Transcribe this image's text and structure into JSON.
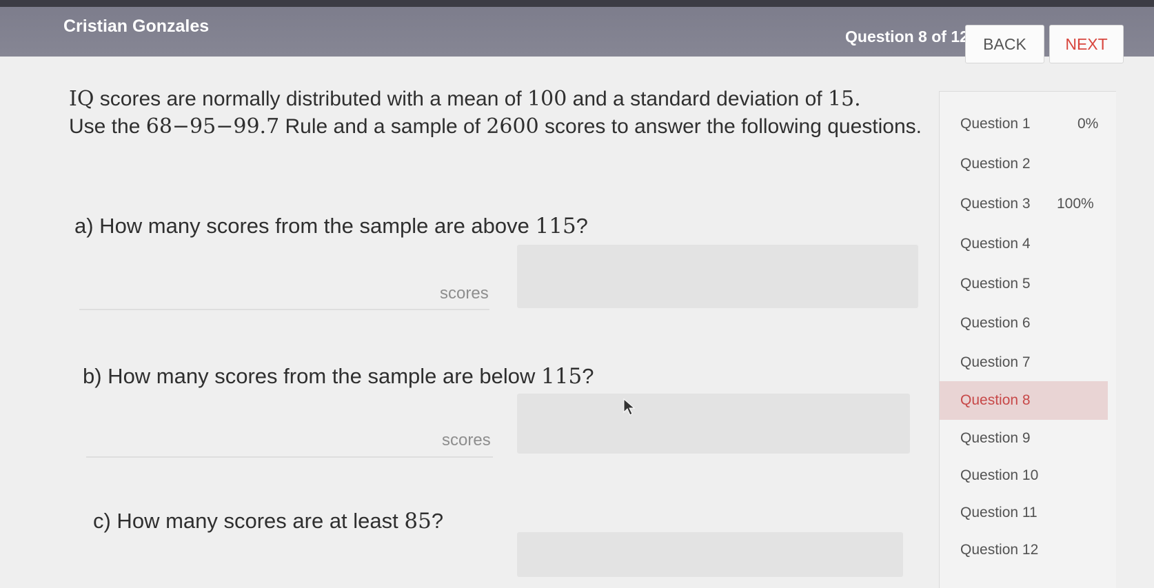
{
  "header": {
    "student_name": "Cristian Gonzales",
    "question_counter": "Question 8 of 12",
    "back_label": "BACK",
    "next_label": "NEXT"
  },
  "prompt": {
    "part1": "IQ",
    "part2": " scores are normally distributed with a mean of ",
    "mean": "100",
    "part3": " and a standard deviation of ",
    "sd": "15.",
    "part4": "Use the ",
    "rule": "68−95−99.7",
    "part5": " Rule and a sample of ",
    "sample": "2600",
    "part6": " scores to answer the following questions."
  },
  "questions": [
    {
      "text_prefix": "a) How many scores from the sample are above ",
      "number": "115",
      "text_suffix": "?",
      "unit": "scores",
      "value": ""
    },
    {
      "text_prefix": "b) How many scores from the sample are below ",
      "number": "115",
      "text_suffix": "?",
      "unit": "scores",
      "value": ""
    },
    {
      "text_prefix": "c) How many scores are at least ",
      "number": "85",
      "text_suffix": "?",
      "unit": "",
      "value": ""
    }
  ],
  "nav": {
    "items": [
      {
        "label": "Question 1",
        "percent": "0%"
      },
      {
        "label": "Question 2",
        "percent": ""
      },
      {
        "label": "Question 3",
        "percent": "100%"
      },
      {
        "label": "Question 4",
        "percent": ""
      },
      {
        "label": "Question 5",
        "percent": ""
      },
      {
        "label": "Question 6",
        "percent": ""
      },
      {
        "label": "Question 7",
        "percent": ""
      },
      {
        "label": "Question 8",
        "percent": ""
      },
      {
        "label": "Question 9",
        "percent": ""
      },
      {
        "label": "Question 10",
        "percent": ""
      },
      {
        "label": "Question 11",
        "percent": ""
      },
      {
        "label": "Question 12",
        "percent": ""
      }
    ],
    "current_label": "Question 8"
  },
  "colors": {
    "header_bg": "#858593",
    "next_text": "#d8463e",
    "current_bg": "#e9d4d4"
  }
}
